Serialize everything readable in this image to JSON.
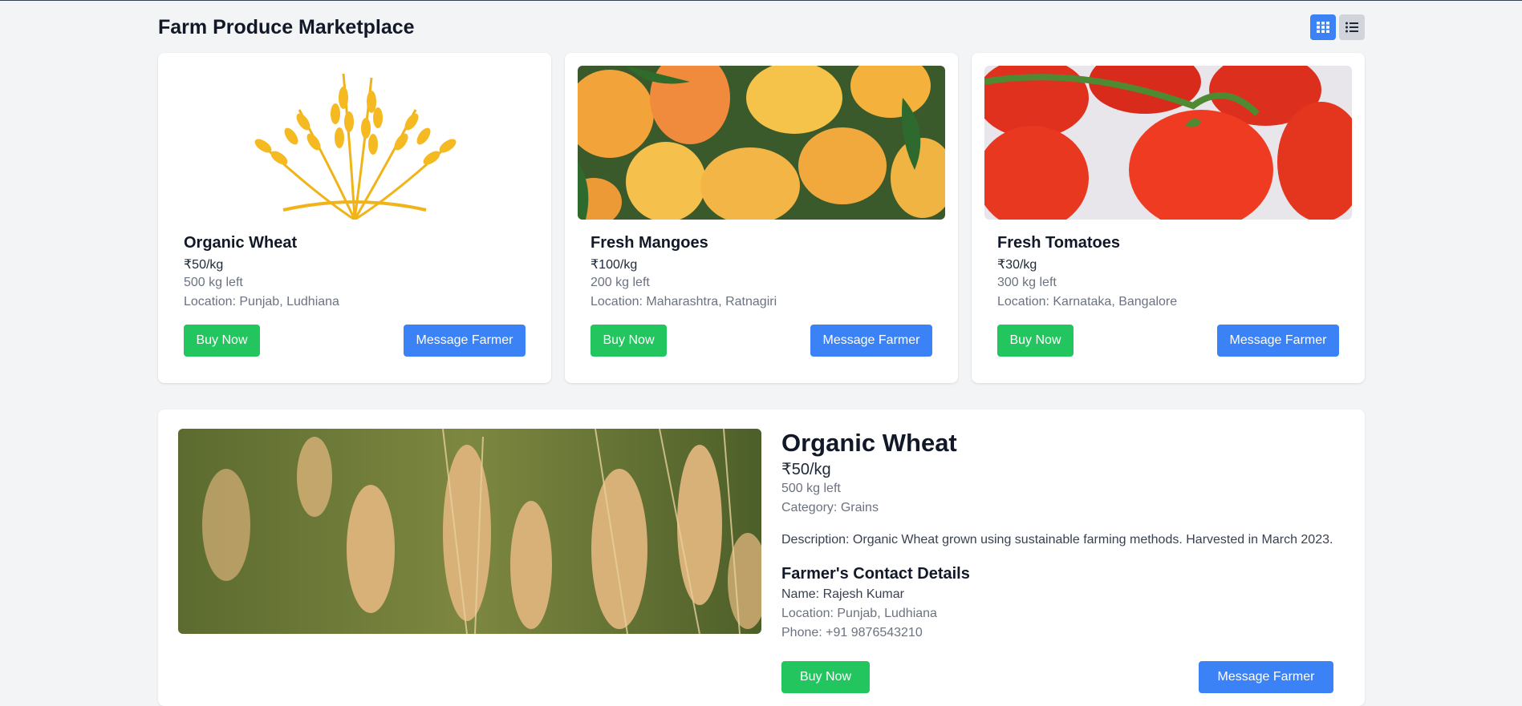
{
  "page": {
    "title": "Farm Produce Marketplace"
  },
  "view_toggle": {
    "grid_icon": "grid-icon",
    "list_icon": "list-icon",
    "active": "grid"
  },
  "products": [
    {
      "name": "Organic Wheat",
      "price": "₹50/kg",
      "quantity": "500 kg left",
      "location": "Location: Punjab, Ludhiana",
      "buy_label": "Buy Now",
      "message_label": "Message Farmer"
    },
    {
      "name": "Fresh Mangoes",
      "price": "₹100/kg",
      "quantity": "200 kg left",
      "location": "Location: Maharashtra, Ratnagiri",
      "buy_label": "Buy Now",
      "message_label": "Message Farmer"
    },
    {
      "name": "Fresh Tomatoes",
      "price": "₹30/kg",
      "quantity": "300 kg left",
      "location": "Location: Karnataka, Bangalore",
      "buy_label": "Buy Now",
      "message_label": "Message Farmer"
    }
  ],
  "detail": {
    "name": "Organic Wheat",
    "price": "₹50/kg",
    "quantity": "500 kg left",
    "category": "Category: Grains",
    "description": "Description: Organic Wheat grown using sustainable farming methods. Harvested in March 2023.",
    "contact_title": "Farmer's Contact Details",
    "contact_name": "Name: Rajesh Kumar",
    "contact_location": "Location: Punjab, Ludhiana",
    "contact_phone": "Phone: +91 9876543210",
    "buy_label": "Buy Now",
    "message_label": "Message Farmer"
  },
  "colors": {
    "accent_blue": "#3b82f6",
    "accent_green": "#22c55e",
    "background": "#f3f4f6"
  }
}
